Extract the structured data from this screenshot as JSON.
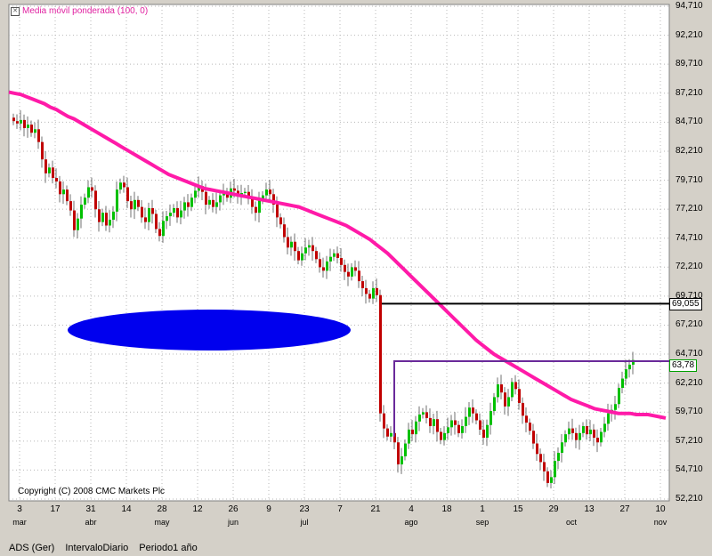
{
  "legend": {
    "label": "Media móvil ponderada (100, 0)",
    "icon": "close-icon",
    "color": "#e020a0"
  },
  "copyright": "Copyright (C) 2008 CMC Markets Plc",
  "status": {
    "symbol": "ADS (Ger)",
    "interval": "IntervaloDiario",
    "period": "Periodo1 año"
  },
  "price_tags": [
    {
      "label": "69,055",
      "value": 69.055,
      "border": "#000000"
    },
    {
      "label": "63,78",
      "value": 63.78,
      "border": "#00a000"
    }
  ],
  "colors": {
    "up": "#00c000",
    "down": "#c00000",
    "ma": "#ff1aa8",
    "ellipse": "#0000ee",
    "support": "#000000",
    "resistance": "#6a2a9a"
  },
  "chart_data": {
    "type": "candlestick",
    "title": "",
    "ylim": [
      52.21,
      94.71
    ],
    "y_ticks": [
      "94,710",
      "92,210",
      "89,710",
      "87,210",
      "84,710",
      "82,210",
      "79,710",
      "77,210",
      "74,710",
      "72,210",
      "69,710",
      "67,210",
      "64,710",
      "62,210",
      "59,710",
      "57,210",
      "54,710",
      "52,210"
    ],
    "x_ticks": [
      {
        "label": "3",
        "index": 2
      },
      {
        "label": "17",
        "index": 12
      },
      {
        "label": "31",
        "index": 22
      },
      {
        "label": "14",
        "index": 32
      },
      {
        "label": "28",
        "index": 42
      },
      {
        "label": "12",
        "index": 52
      },
      {
        "label": "26",
        "index": 62
      },
      {
        "label": "9",
        "index": 72
      },
      {
        "label": "23",
        "index": 82
      },
      {
        "label": "7",
        "index": 92
      },
      {
        "label": "21",
        "index": 102
      },
      {
        "label": "4",
        "index": 112
      },
      {
        "label": "18",
        "index": 122
      },
      {
        "label": "1",
        "index": 132
      },
      {
        "label": "15",
        "index": 142
      },
      {
        "label": "29",
        "index": 152
      },
      {
        "label": "13",
        "index": 162
      },
      {
        "label": "27",
        "index": 172
      },
      {
        "label": "10",
        "index": 182
      }
    ],
    "x_months": [
      {
        "label": "mar",
        "index": 2
      },
      {
        "label": "abr",
        "index": 22
      },
      {
        "label": "may",
        "index": 42
      },
      {
        "label": "jun",
        "index": 62
      },
      {
        "label": "jul",
        "index": 82
      },
      {
        "label": "ago",
        "index": 112
      },
      {
        "label": "sep",
        "index": 132
      },
      {
        "label": "oct",
        "index": 157
      },
      {
        "label": "nov",
        "index": 182
      }
    ],
    "close_series": [
      84.8,
      84.6,
      84.9,
      84.2,
      84.5,
      83.8,
      84.1,
      83.0,
      81.5,
      80.3,
      80.8,
      79.9,
      79.6,
      78.5,
      78.9,
      77.9,
      77.1,
      75.4,
      76.4,
      77.6,
      78.2,
      79.1,
      78.8,
      77.2,
      76.1,
      76.9,
      75.8,
      76.3,
      77.0,
      78.9,
      79.5,
      79.1,
      77.9,
      77.2,
      78.0,
      77.4,
      76.5,
      76.1,
      77.3,
      76.8,
      75.5,
      74.9,
      76.2,
      76.6,
      76.9,
      77.3,
      76.5,
      77.1,
      77.8,
      77.4,
      78.2,
      78.8,
      79.2,
      78.7,
      77.6,
      78.0,
      77.4,
      77.8,
      78.4,
      78.7,
      78.2,
      79.0,
      78.8,
      78.4,
      78.6,
      78.7,
      78.1,
      77.4,
      76.9,
      78.0,
      78.4,
      78.9,
      78.5,
      77.6,
      76.5,
      75.9,
      74.8,
      73.9,
      74.4,
      73.6,
      72.8,
      73.4,
      73.9,
      74.1,
      73.6,
      72.9,
      72.2,
      71.9,
      72.7,
      73.1,
      73.4,
      73.0,
      72.4,
      71.8,
      71.4,
      72.2,
      71.9,
      71.0,
      70.4,
      69.9,
      69.5,
      70.4,
      69.8,
      59.6,
      58.3,
      57.6,
      57.9,
      57.1,
      55.2,
      55.9,
      57.0,
      58.2,
      57.8,
      58.9,
      59.5,
      59.7,
      59.2,
      58.5,
      59.1,
      58.0,
      57.3,
      57.9,
      58.4,
      59.0,
      58.6,
      57.9,
      58.5,
      59.3,
      60.1,
      59.6,
      59.0,
      58.2,
      57.5,
      58.6,
      59.8,
      61.0,
      62.1,
      61.4,
      60.2,
      61.0,
      62.3,
      61.7,
      60.5,
      59.4,
      58.8,
      58.1,
      57.0,
      56.1,
      55.4,
      54.6,
      53.6,
      54.1,
      55.5,
      56.2,
      57.1,
      57.8,
      58.3,
      57.9,
      57.3,
      57.9,
      58.5,
      57.8,
      58.2,
      57.5,
      57.1,
      58.0,
      58.7,
      59.6,
      59.9,
      60.4,
      61.8,
      62.6,
      63.4,
      63.8,
      64.2
    ]
  },
  "ma_series": [
    87.3,
    87.2,
    87.1,
    86.9,
    86.7,
    86.5,
    86.3,
    86.0,
    85.8,
    85.5,
    85.2,
    85.0,
    84.7,
    84.4,
    84.1,
    83.8,
    83.5,
    83.2,
    82.9,
    82.6,
    82.3,
    82.0,
    81.7,
    81.4,
    81.1,
    80.8,
    80.5,
    80.2,
    80.0,
    79.8,
    79.6,
    79.4,
    79.2,
    79.0,
    78.9,
    78.8,
    78.7,
    78.6,
    78.5,
    78.4,
    78.3,
    78.2,
    78.1,
    78.0,
    77.9,
    77.8,
    77.7,
    77.6,
    77.5,
    77.4,
    77.2,
    77.0,
    76.8,
    76.6,
    76.4,
    76.2,
    76.0,
    75.8,
    75.5,
    75.2,
    74.9,
    74.6,
    74.2,
    73.8,
    73.4,
    72.9,
    72.4,
    71.9,
    71.4,
    70.9,
    70.4,
    69.9,
    69.4,
    68.9,
    68.4,
    67.9,
    67.4,
    66.9,
    66.4,
    65.9,
    65.5,
    65.1,
    64.7,
    64.4,
    64.1,
    63.8,
    63.5,
    63.2,
    62.9,
    62.6,
    62.3,
    62.0,
    61.7,
    61.4,
    61.1,
    60.8,
    60.6,
    60.4,
    60.2,
    60.0,
    59.9,
    59.8,
    59.7,
    59.6,
    59.6,
    59.6,
    59.5,
    59.5,
    59.5,
    59.4,
    59.3,
    59.2
  ]
}
